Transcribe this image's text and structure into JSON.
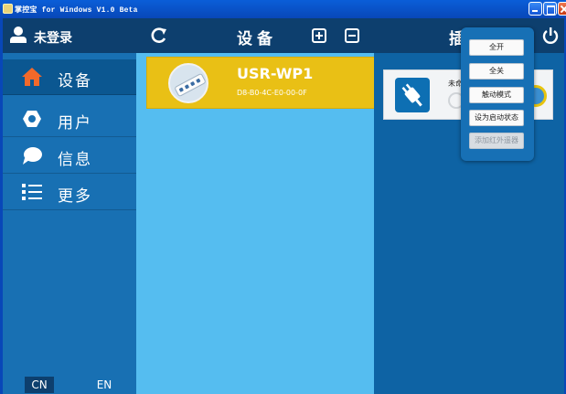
{
  "window": {
    "title": "掌控宝 for Windows V1.0 Beta"
  },
  "sidebar": {
    "user_label": "未登录",
    "items": [
      {
        "label": "设备",
        "icon": "home-icon",
        "active": true
      },
      {
        "label": "用户",
        "icon": "gear-icon",
        "active": false
      },
      {
        "label": "信息",
        "icon": "chat-bubble-icon",
        "active": false
      },
      {
        "label": "更多",
        "icon": "list-icon",
        "active": false
      }
    ],
    "languages": [
      "CN",
      "EN"
    ]
  },
  "devices": {
    "title": "设备",
    "list": [
      {
        "name": "USR-WP1",
        "mac": "D8-B0-4C-E0-00-0F"
      }
    ]
  },
  "right_panel": {
    "title": "插",
    "socket_status": "未命"
  },
  "popup_menu": {
    "items": [
      {
        "label": "全开",
        "enabled": true
      },
      {
        "label": "全关",
        "enabled": true
      },
      {
        "label": "触动模式",
        "enabled": true
      },
      {
        "label": "设为启动状态",
        "enabled": true
      },
      {
        "label": "添加红外遥器",
        "enabled": false
      }
    ]
  },
  "colors": {
    "header_bg": "#0d3f6e",
    "sidebar_bg": "#1870b3",
    "list_bg": "#55bdf0",
    "device_card": "#e9c015",
    "home_icon": "#f2692a"
  }
}
